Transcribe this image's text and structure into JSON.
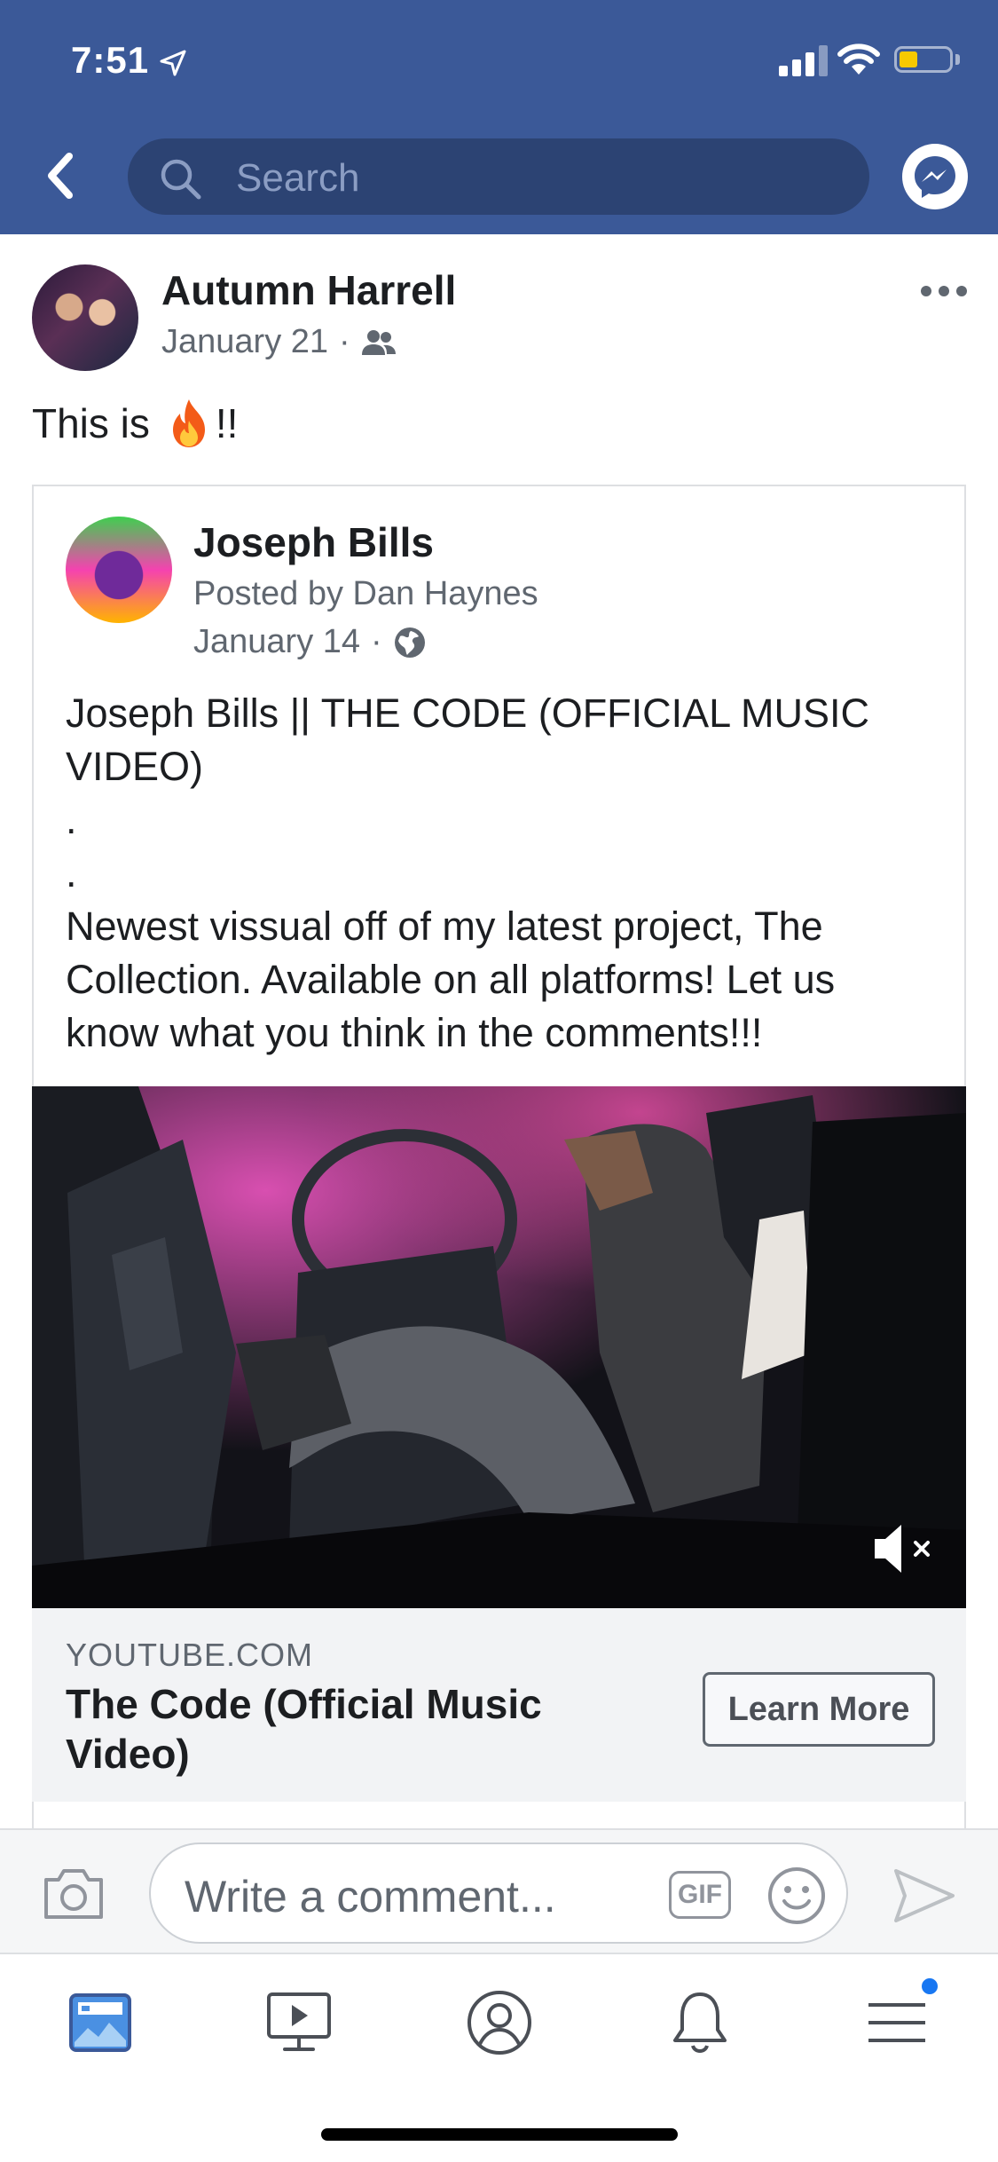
{
  "status_bar": {
    "time": "7:51"
  },
  "header": {
    "search_placeholder": "Search"
  },
  "post": {
    "author": "Autumn Harrell",
    "date": "January 21",
    "text_prefix": "This is",
    "text_suffix": "!!",
    "shared": {
      "author": "Joseph Bills",
      "posted_by": "Posted by Dan Haynes",
      "date": "January 14",
      "body_lines": [
        "Joseph Bills || THE CODE (OFFICIAL MUSIC",
        "VIDEO)",
        ".",
        ".",
        "Newest vissual off of my latest project, The",
        "Collection. Available on all platforms! Let us",
        "know what you think in the comments!!!"
      ],
      "link": {
        "domain": "YOUTUBE.COM",
        "title": "The Code (Official Music Video)",
        "cta": "Learn More"
      }
    }
  },
  "comment_bar": {
    "placeholder": "Write a comment...",
    "gif_label": "GIF"
  },
  "bottom_nav": {
    "items": [
      "news-feed",
      "watch",
      "profile",
      "notifications",
      "menu"
    ]
  },
  "colors": {
    "header_bg": "#3b5998",
    "accent": "#1877f2",
    "battery": "#f7c900"
  }
}
